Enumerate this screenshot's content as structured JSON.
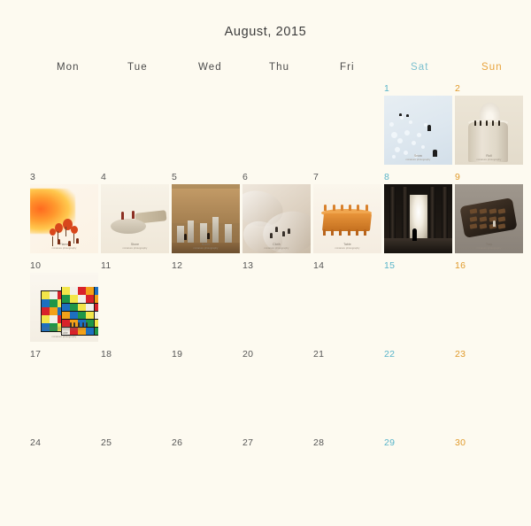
{
  "page": {
    "background_color": "#fdfaf0",
    "title": "August, 2015",
    "text_color": "#3b3b3b"
  },
  "colors": {
    "weekday_default": "#4a4a4a",
    "saturday": "#7cc0cf",
    "sunday": "#e8a33d",
    "day_number_default": "#555555",
    "day_number_saturday": "#58b4c9",
    "day_number_sunday": "#e09a2b"
  },
  "weekdays": [
    {
      "label": "Mon",
      "kind": "weekday"
    },
    {
      "label": "Tue",
      "kind": "weekday"
    },
    {
      "label": "Wed",
      "kind": "weekday"
    },
    {
      "label": "Thu",
      "kind": "weekday"
    },
    {
      "label": "Fri",
      "kind": "weekday"
    },
    {
      "label": "Sat",
      "kind": "saturday"
    },
    {
      "label": "Sun",
      "kind": "sunday"
    }
  ],
  "weeks": [
    {
      "days": [
        {
          "number": "",
          "kind": "blank",
          "has_photo": false
        },
        {
          "number": "",
          "kind": "blank",
          "has_photo": false
        },
        {
          "number": "",
          "kind": "blank",
          "has_photo": false
        },
        {
          "number": "",
          "kind": "blank",
          "has_photo": false
        },
        {
          "number": "",
          "kind": "blank",
          "has_photo": false
        },
        {
          "number": "1",
          "kind": "saturday",
          "has_photo": true,
          "art": "snow",
          "caption_title": "Snow",
          "caption_sub": "miniature photography"
        },
        {
          "number": "2",
          "kind": "sunday",
          "has_photo": true,
          "art": "roll",
          "caption_title": "Roll",
          "caption_sub": "miniature photography"
        }
      ]
    },
    {
      "days": [
        {
          "number": "3",
          "kind": "weekday",
          "has_photo": true,
          "art": "autumn",
          "caption_title": "Flame",
          "caption_sub": "miniature photography"
        },
        {
          "number": "4",
          "kind": "weekday",
          "has_photo": true,
          "art": "disc",
          "caption_title": "Stone",
          "caption_sub": "miniature photography"
        },
        {
          "number": "5",
          "kind": "weekday",
          "has_photo": true,
          "art": "ruins",
          "caption_title": "Ruins",
          "caption_sub": "miniature photography"
        },
        {
          "number": "6",
          "kind": "weekday",
          "has_photo": true,
          "art": "cloth",
          "caption_title": "Cloth",
          "caption_sub": "miniature photography"
        },
        {
          "number": "7",
          "kind": "weekday",
          "has_photo": true,
          "art": "table",
          "caption_title": "Table",
          "caption_sub": "miniature photography"
        },
        {
          "number": "8",
          "kind": "saturday",
          "has_photo": true,
          "art": "dark",
          "caption_title": "",
          "caption_sub": ""
        },
        {
          "number": "9",
          "kind": "sunday",
          "has_photo": true,
          "art": "tray",
          "caption_title": "Tray",
          "caption_sub": "miniature photography"
        }
      ]
    },
    {
      "days": [
        {
          "number": "10",
          "kind": "weekday",
          "has_photo": true,
          "art": "rubik",
          "caption_title": "Cube",
          "caption_sub": "miniature photography"
        },
        {
          "number": "11",
          "kind": "weekday",
          "has_photo": false
        },
        {
          "number": "12",
          "kind": "weekday",
          "has_photo": false
        },
        {
          "number": "13",
          "kind": "weekday",
          "has_photo": false
        },
        {
          "number": "14",
          "kind": "weekday",
          "has_photo": false
        },
        {
          "number": "15",
          "kind": "saturday",
          "has_photo": false
        },
        {
          "number": "16",
          "kind": "sunday",
          "has_photo": false
        }
      ]
    },
    {
      "days": [
        {
          "number": "17",
          "kind": "weekday",
          "has_photo": false
        },
        {
          "number": "18",
          "kind": "weekday",
          "has_photo": false
        },
        {
          "number": "19",
          "kind": "weekday",
          "has_photo": false
        },
        {
          "number": "20",
          "kind": "weekday",
          "has_photo": false
        },
        {
          "number": "21",
          "kind": "weekday",
          "has_photo": false
        },
        {
          "number": "22",
          "kind": "saturday",
          "has_photo": false
        },
        {
          "number": "23",
          "kind": "sunday",
          "has_photo": false
        }
      ]
    },
    {
      "days": [
        {
          "number": "24",
          "kind": "weekday",
          "has_photo": false
        },
        {
          "number": "25",
          "kind": "weekday",
          "has_photo": false
        },
        {
          "number": "26",
          "kind": "weekday",
          "has_photo": false
        },
        {
          "number": "27",
          "kind": "weekday",
          "has_photo": false
        },
        {
          "number": "28",
          "kind": "weekday",
          "has_photo": false
        },
        {
          "number": "29",
          "kind": "saturday",
          "has_photo": false
        },
        {
          "number": "30",
          "kind": "sunday",
          "has_photo": false
        }
      ]
    }
  ]
}
